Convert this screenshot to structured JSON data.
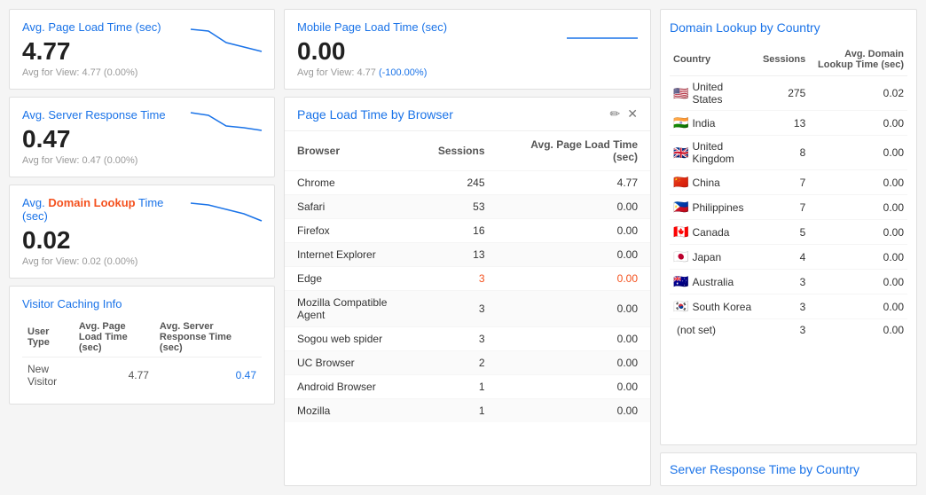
{
  "left": {
    "cards": [
      {
        "id": "avg-page-load",
        "title": "Avg. Page Load Time (sec)",
        "titleHighlight": null,
        "value": "4.77",
        "sub": "Avg for View: 4.77 (0.00%)"
      },
      {
        "id": "avg-server-response",
        "title": "Avg. Server Response Time",
        "titleHighlight": null,
        "value": "0.47",
        "sub": "Avg for View: 0.47 (0.00%)"
      },
      {
        "id": "avg-domain-lookup",
        "title_prefix": "Avg. ",
        "title_highlight": "Domain Lookup",
        "title_suffix": " Time (sec)",
        "value": "0.02",
        "sub": "Avg for View: 0.02 (0.00%)"
      }
    ],
    "visitor_caching": {
      "title": "Visitor Caching Info",
      "columns": [
        "User Type",
        "Avg. Page Load Time (sec)",
        "Avg. Server Response Time (sec)"
      ],
      "rows": [
        {
          "user_type": "New Visitor",
          "page_load": "4.77",
          "server_response": "0.47"
        }
      ]
    }
  },
  "middle": {
    "top_cards": [
      {
        "id": "mobile-page-load",
        "title": "Mobile Page Load Time (sec)",
        "value": "0.00",
        "sub": "Avg for View: 4.77 (-100.00%)",
        "sub_highlight": "(-100.00%)"
      }
    ],
    "browser_table": {
      "title": "Page Load Time by Browser",
      "columns": [
        "Browser",
        "Sessions",
        "Avg. Page Load Time (sec)"
      ],
      "rows": [
        {
          "browser": "Chrome",
          "sessions": "245",
          "avg_load": "4.77",
          "orange": false
        },
        {
          "browser": "Safari",
          "sessions": "53",
          "avg_load": "0.00",
          "orange": false
        },
        {
          "browser": "Firefox",
          "sessions": "16",
          "avg_load": "0.00",
          "orange": false
        },
        {
          "browser": "Internet Explorer",
          "sessions": "13",
          "avg_load": "0.00",
          "orange": false
        },
        {
          "browser": "Edge",
          "sessions": "3",
          "avg_load": "0.00",
          "orange": true
        },
        {
          "browser": "Mozilla Compatible Agent",
          "sessions": "3",
          "avg_load": "0.00",
          "orange": false
        },
        {
          "browser": "Sogou web spider",
          "sessions": "3",
          "avg_load": "0.00",
          "orange": false
        },
        {
          "browser": "UC Browser",
          "sessions": "2",
          "avg_load": "0.00",
          "orange": false
        },
        {
          "browser": "Android Browser",
          "sessions": "1",
          "avg_load": "0.00",
          "orange": false
        },
        {
          "browser": "Mozilla",
          "sessions": "1",
          "avg_load": "0.00",
          "orange": false
        }
      ]
    }
  },
  "right": {
    "domain_lookup": {
      "title": "Domain Lookup by Country",
      "columns": [
        "Country",
        "Sessions",
        "Avg. Domain Lookup Time (sec)"
      ],
      "rows": [
        {
          "flag": "🇺🇸",
          "country": "United States",
          "sessions": "275",
          "avg_domain": "0.02"
        },
        {
          "flag": "🇮🇳",
          "country": "India",
          "sessions": "13",
          "avg_domain": "0.00"
        },
        {
          "flag": "🇬🇧",
          "country": "United Kingdom",
          "sessions": "8",
          "avg_domain": "0.00"
        },
        {
          "flag": "🇨🇳",
          "country": "China",
          "sessions": "7",
          "avg_domain": "0.00"
        },
        {
          "flag": "🇵🇭",
          "country": "Philippines",
          "sessions": "7",
          "avg_domain": "0.00"
        },
        {
          "flag": "🇨🇦",
          "country": "Canada",
          "sessions": "5",
          "avg_domain": "0.00"
        },
        {
          "flag": "🇯🇵",
          "country": "Japan",
          "sessions": "4",
          "avg_domain": "0.00"
        },
        {
          "flag": "🇦🇺",
          "country": "Australia",
          "sessions": "3",
          "avg_domain": "0.00"
        },
        {
          "flag": "🇰🇷",
          "country": "South Korea",
          "sessions": "3",
          "avg_domain": "0.00"
        },
        {
          "flag": "",
          "country": "(not set)",
          "sessions": "3",
          "avg_domain": "0.00"
        }
      ]
    },
    "server_response_title": "Server Response Time by Country"
  }
}
